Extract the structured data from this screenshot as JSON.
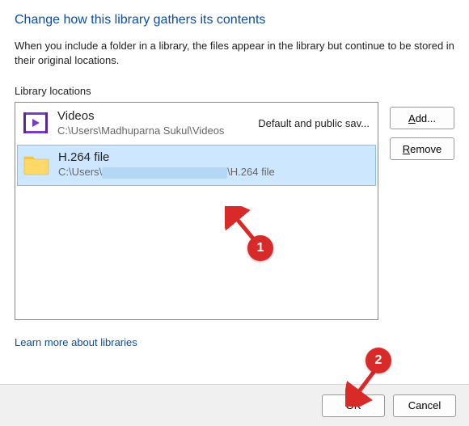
{
  "heading": "Change how this library gathers its contents",
  "description": "When you include a folder in a library, the files appear in the library but continue to be stored in their original locations.",
  "section_label": "Library locations",
  "locations": [
    {
      "title": "Videos",
      "path": "C:\\Users\\Madhuparna Sukul\\Videos",
      "status": "Default and public sav...",
      "icon": "videos"
    },
    {
      "title": "H.264 file",
      "path_prefix": "C:\\Users\\",
      "path_suffix": "\\H.264 file",
      "icon": "folder",
      "selected": true
    }
  ],
  "buttons": {
    "add": "Add...",
    "remove": "Remove",
    "ok": "OK",
    "cancel": "Cancel"
  },
  "link": "Learn more about libraries",
  "annotations": {
    "badge1": "1",
    "badge2": "2"
  },
  "colors": {
    "accent": "#0a4da2",
    "annotation": "#d82a28"
  }
}
